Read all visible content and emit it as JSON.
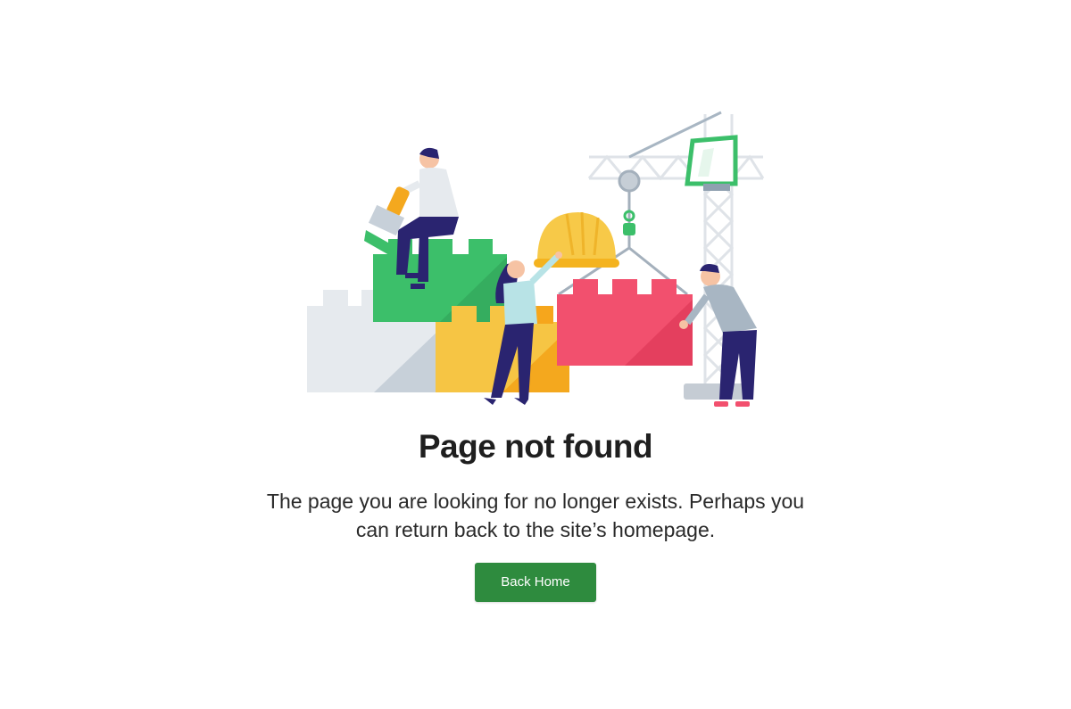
{
  "error": {
    "title": "Page not found",
    "message_line1": "The page you are looking for no longer exists. Perhaps you",
    "message_line2": "can return back to the site’s homepage.",
    "button_label": "Back Home"
  },
  "colors": {
    "button": "#2e8b3e",
    "green_block": "#3cbf6a",
    "yellow_block": "#f6c544",
    "red_block": "#f2506e",
    "grey_block": "#e6eaee",
    "crane": "#d9dee4",
    "hardhat": "#f7c948",
    "navy": "#2a2470"
  },
  "illustration": {
    "icon": "construction-blocks-illustration"
  }
}
